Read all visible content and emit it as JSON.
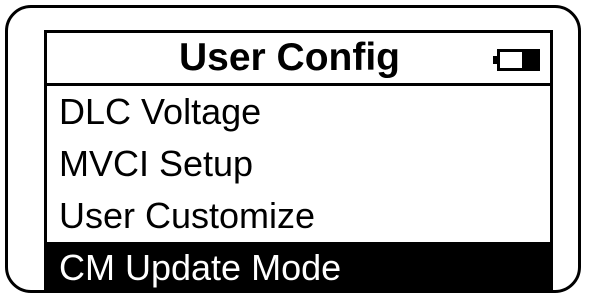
{
  "header": {
    "title": "User Config",
    "battery_icon": "battery-icon"
  },
  "menu": {
    "items": [
      {
        "label": "DLC Voltage",
        "selected": false
      },
      {
        "label": "MVCI Setup",
        "selected": false
      },
      {
        "label": "User Customize",
        "selected": false
      },
      {
        "label": "CM Update Mode",
        "selected": true
      }
    ]
  },
  "colors": {
    "foreground": "#000000",
    "background": "#ffffff",
    "highlight": "#000000",
    "highlight_text": "#ffffff"
  }
}
